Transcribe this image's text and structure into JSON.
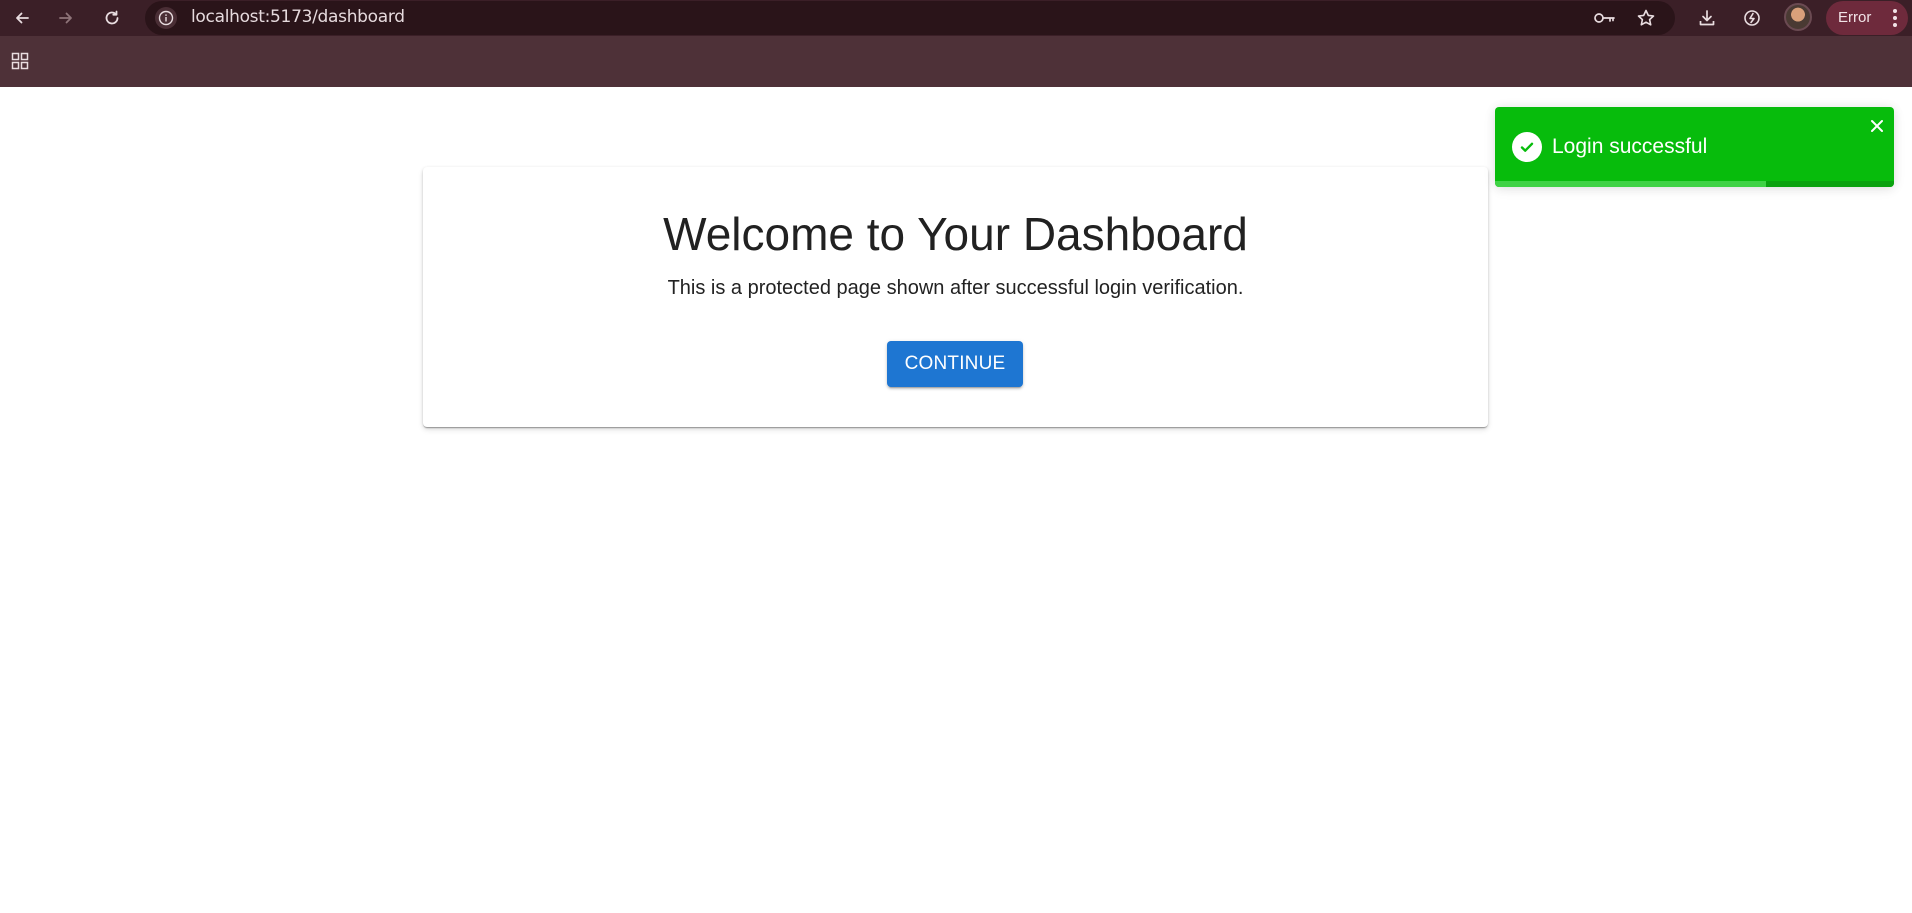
{
  "browser": {
    "url": "localhost:5173/dashboard",
    "profile_status": "Error",
    "icons": {
      "back": "back-arrow-icon",
      "forward": "forward-arrow-icon",
      "reload": "reload-icon",
      "site_info": "info-icon",
      "passwords": "key-icon",
      "bookmark": "star-icon",
      "downloads": "download-icon",
      "extension": "extension-icon",
      "menu": "more-vertical-icon",
      "apps": "apps-grid-icon"
    }
  },
  "main": {
    "title": "Welcome to Your Dashboard",
    "subtitle": "This is a protected page shown after successful login verification.",
    "continue_label": "CONTINUE"
  },
  "toast": {
    "message": "Login successful",
    "type": "success",
    "progress_remaining": 0.68,
    "color": "#07bc0c"
  },
  "colors": {
    "primary_button": "#1e76d2",
    "chrome_top": "#3b1f27",
    "chrome_bookmarks": "#4e3138"
  }
}
